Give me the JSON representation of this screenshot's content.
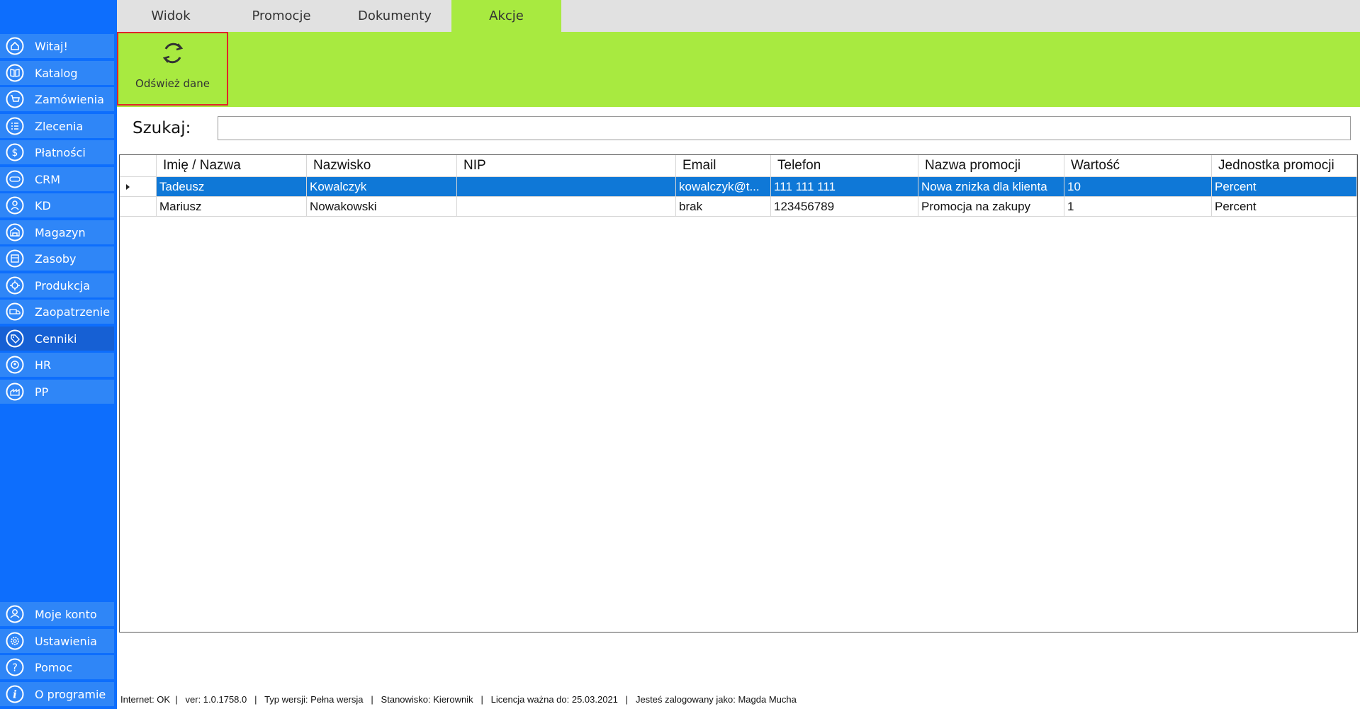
{
  "sidebar": {
    "items": [
      {
        "label": "Witaj!",
        "icon": "home-icon"
      },
      {
        "label": "Katalog",
        "icon": "book-icon"
      },
      {
        "label": "Zamówienia",
        "icon": "cart-icon"
      },
      {
        "label": "Zlecenia",
        "icon": "list-icon"
      },
      {
        "label": "Płatności",
        "icon": "dollar-icon"
      },
      {
        "label": "CRM",
        "icon": "crm-icon"
      },
      {
        "label": "KD",
        "icon": "user-lock-icon"
      },
      {
        "label": "Magazyn",
        "icon": "warehouse-icon"
      },
      {
        "label": "Zasoby",
        "icon": "resources-icon"
      },
      {
        "label": "Produkcja",
        "icon": "factory-icon"
      },
      {
        "label": "Zaopatrzenie",
        "icon": "truck-icon"
      },
      {
        "label": "Cenniki",
        "icon": "tag-icon",
        "active": true
      },
      {
        "label": "HR",
        "icon": "hr-icon"
      },
      {
        "label": "PP",
        "icon": "pp-icon"
      }
    ],
    "bottom_items": [
      {
        "label": "Moje konto",
        "icon": "account-icon"
      },
      {
        "label": "Ustawienia",
        "icon": "gear-icon"
      },
      {
        "label": "Pomoc",
        "icon": "help-icon"
      },
      {
        "label": "O programie",
        "icon": "info-icon"
      }
    ]
  },
  "tabs": [
    {
      "label": "Widok"
    },
    {
      "label": "Promocje"
    },
    {
      "label": "Dokumenty"
    },
    {
      "label": "Akcje",
      "active": true
    }
  ],
  "ribbon": {
    "refresh_label": "Odśwież dane"
  },
  "search": {
    "label": "Szukaj:",
    "value": ""
  },
  "grid": {
    "columns": [
      "Imię / Nazwa",
      "Nazwisko",
      "NIP",
      "Email",
      "Telefon",
      "Nazwa promocji",
      "Wartość",
      "Jednostka promocji"
    ],
    "rows": [
      [
        "Tadeusz",
        "Kowalczyk",
        "",
        "kowalczyk@t...",
        "111 111 111",
        "Nowa znizka dla klienta",
        "10",
        "Percent"
      ],
      [
        "Mariusz",
        "Nowakowski",
        "",
        "brak",
        "123456789",
        "Promocja na zakupy",
        "1",
        "Percent"
      ]
    ],
    "selected_row": 0
  },
  "statusbar": {
    "text": "Internet: OK  |   ver: 1.0.1758.0   |   Typ wersji: Pełna wersja   |   Stanowisko: Kierownik   |   Licencja ważna do: 25.03.2021   |   Jesteś zalogowany jako: Magda Mucha"
  },
  "colors": {
    "sidebar_bg": "#0d6efd",
    "sidebar_item": "#2f86f7",
    "ribbon_green": "#a8ea40",
    "selection_blue": "#0f78d7",
    "highlight_red": "#e0242a"
  }
}
